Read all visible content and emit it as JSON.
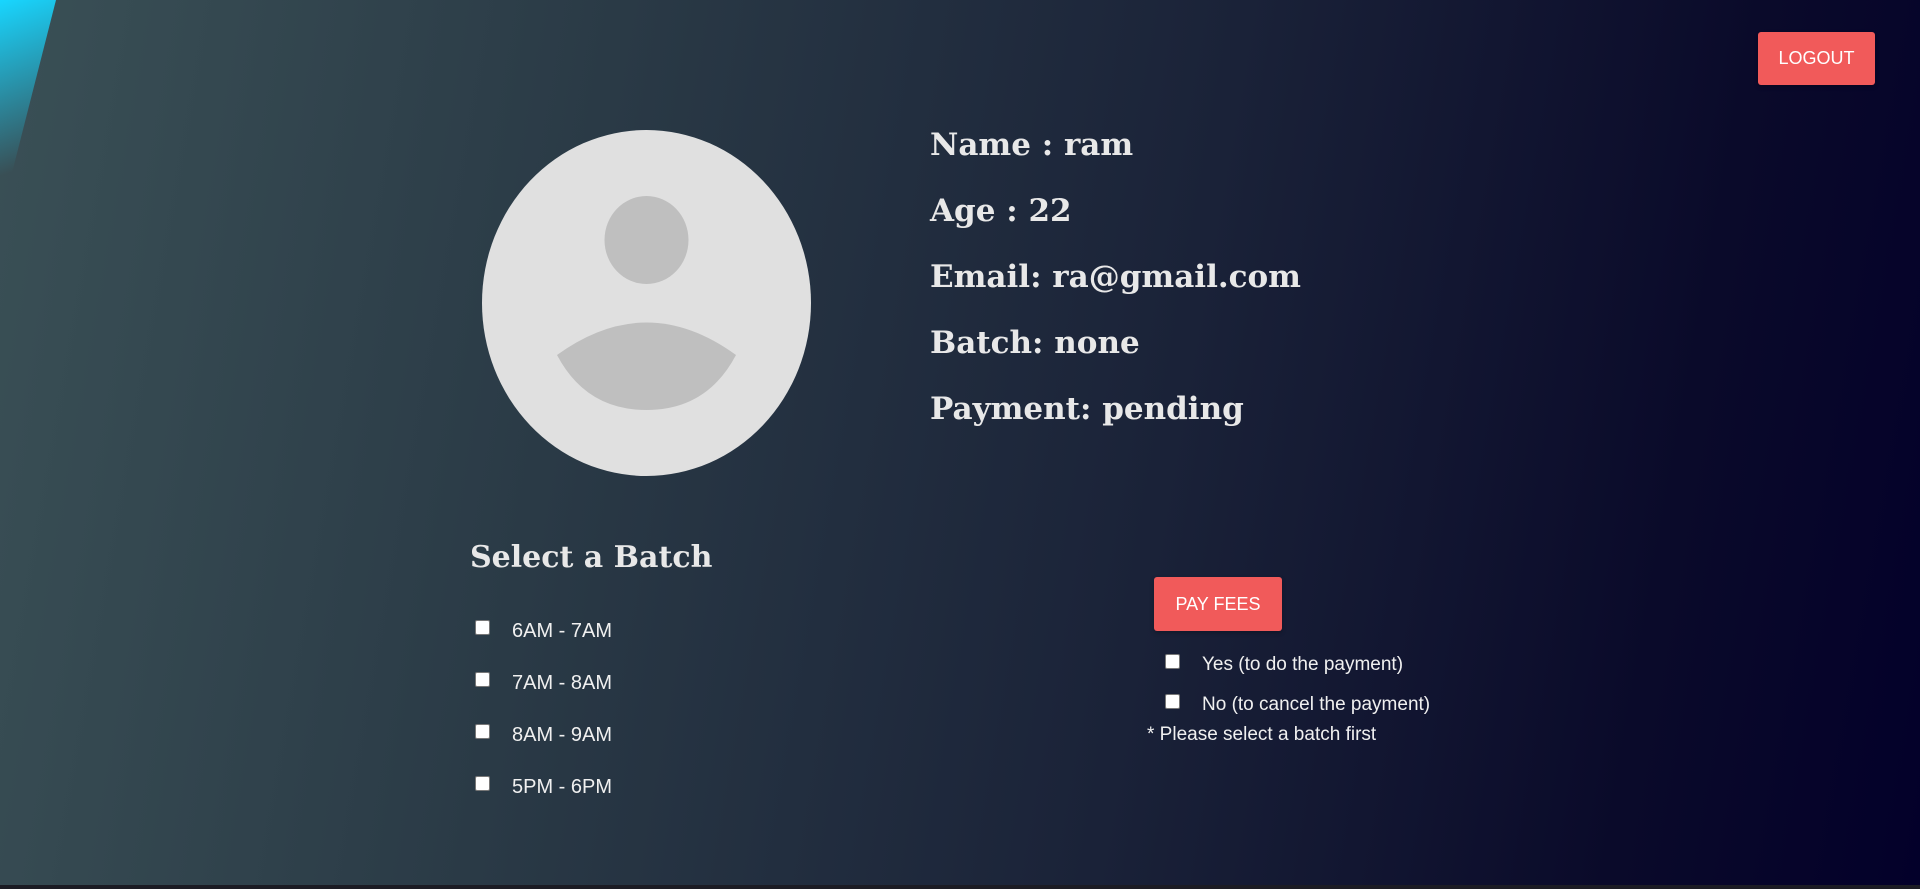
{
  "header": {
    "logout_label": "LOGOUT"
  },
  "profile": {
    "name": "Name : ram",
    "age": "Age : 22",
    "email": "Email: ra@gmail.com",
    "batch": "Batch: none",
    "payment": "Payment: pending"
  },
  "batch_section": {
    "title": "Select a Batch",
    "options": [
      {
        "label": "6AM - 7AM",
        "checked": false
      },
      {
        "label": "7AM - 8AM",
        "checked": false
      },
      {
        "label": "8AM - 9AM",
        "checked": false
      },
      {
        "label": "5PM - 6PM",
        "checked": false
      }
    ]
  },
  "payment_section": {
    "pay_label": "PAY FEES",
    "options": [
      {
        "label": "Yes (to do the payment)",
        "checked": false
      },
      {
        "label": "No (to cancel the payment)",
        "checked": false
      }
    ],
    "note": "* Please select a batch first"
  },
  "colors": {
    "accent": "#f15a5a",
    "avatar_bg": "#e0e0e0",
    "avatar_fg": "#bfbfbf"
  }
}
